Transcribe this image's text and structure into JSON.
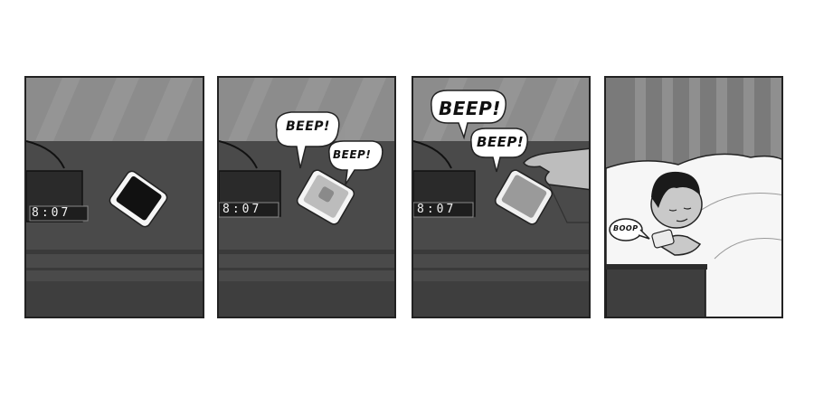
{
  "comic": {
    "panels": [
      {
        "id": 1,
        "clock_time": "8:07"
      },
      {
        "id": 2,
        "clock_time": "8:07",
        "sound_effects": [
          "BEEP!",
          "BEEP!"
        ]
      },
      {
        "id": 3,
        "clock_time": "8:07",
        "sound_effects": [
          "BEEP!",
          "BEEP!"
        ]
      },
      {
        "id": 4,
        "sound_effects": [
          "BOOP"
        ]
      }
    ]
  }
}
